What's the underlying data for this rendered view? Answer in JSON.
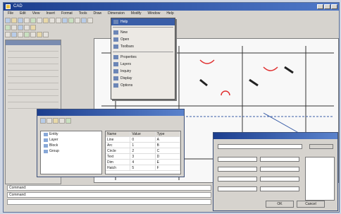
{
  "app": {
    "title": "CAD"
  },
  "menubar": {
    "items": [
      "File",
      "Edit",
      "View",
      "Insert",
      "Format",
      "Tools",
      "Draw",
      "Dimension",
      "Modify",
      "Window",
      "Help"
    ]
  },
  "dropdown": {
    "items": [
      "Help",
      "New",
      "Open",
      "Toolbars",
      "Properties",
      "Layers",
      "Inquiry",
      "Display",
      "Options"
    ]
  },
  "dialog1": {
    "tree": [
      "Entity",
      "Layer",
      "Block",
      "Group"
    ],
    "grid_headers": [
      "Name",
      "Value",
      "Type"
    ],
    "grid_rows": [
      [
        "Line",
        "0",
        "A"
      ],
      [
        "Arc",
        "1",
        "B"
      ],
      [
        "Circle",
        "2",
        "C"
      ],
      [
        "Text",
        "3",
        "D"
      ],
      [
        "Dim",
        "4",
        "E"
      ],
      [
        "Hatch",
        "5",
        "F"
      ]
    ]
  },
  "dialog2": {
    "ok": "OK",
    "cancel": "Cancel"
  },
  "status": {
    "line1": "Command:",
    "line2": "Command:"
  }
}
